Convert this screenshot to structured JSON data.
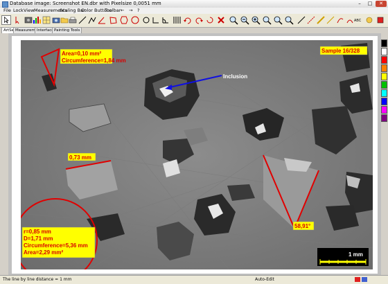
{
  "window": {
    "title": "Database image: Screenshot EN.dbr with Pixelsize 0,0051 mm",
    "min": "–",
    "max": "□",
    "close": "✕"
  },
  "menu": [
    "File",
    "Lock",
    "View",
    "Measurements",
    "Scaling Bar",
    "Color Buttons",
    "Toolbar",
    "←",
    "→",
    "?"
  ],
  "tabs": [
    "ArtSet",
    "Measurement",
    "Interfaces",
    "Painting Tools"
  ],
  "toolbar_icons": [
    "pointer-icon",
    "cursor-icon",
    "open-icon",
    "histogram-icon",
    "grid-icon",
    "camera-icon",
    "folder-icon",
    "print-icon",
    "line-icon",
    "polyline-icon",
    "angle-icon",
    "polygon-icon",
    "circle-icon",
    "ellipse-icon",
    "arc-icon",
    "angle-tool-icon",
    "protractor-icon",
    "grid-lines-icon",
    "undo-icon",
    "redo-icon",
    "erase-icon",
    "delete-icon",
    "zoom-in-icon",
    "zoom-out-icon",
    "zoom-fit-icon",
    "zoom-width-icon",
    "zoom-area-icon",
    "zoom-reset-icon",
    "line-draw-icon",
    "dash-icon",
    "pen-icon",
    "pencil-icon",
    "brush-icon",
    "arc-draw-icon",
    "curve-icon",
    "text-icon",
    "font-icon",
    "color-icon"
  ],
  "toolbar_text": {
    "abc": "ABC"
  },
  "annotations": {
    "area1": "Area=0,10 mm²",
    "circ1": "Circumference=1,84 mm",
    "inclusion": "Inclusion",
    "sample": "Sample 16/328",
    "length": "0,73 mm",
    "angle": "58,91°",
    "circle_r": "r=0,85 mm",
    "circle_d": "D=1,71 mm",
    "circle_circ": "Circumference=5,36 mm",
    "circle_area": "Area=2,29 mm²",
    "scale": "1 mm"
  },
  "palette": [
    "#000000",
    "#ffffff",
    "#ff0000",
    "#ff8000",
    "#ffff00",
    "#00c000",
    "#00ffff",
    "#0000ff",
    "#ff00ff",
    "#800080"
  ],
  "status": {
    "text": "The line by line distance = 1 mm",
    "mode": "Auto-Edit"
  },
  "colors": {
    "annotation_red": "#e00000",
    "label_bg": "#ffff00",
    "arrow_blue": "#1010e0"
  }
}
